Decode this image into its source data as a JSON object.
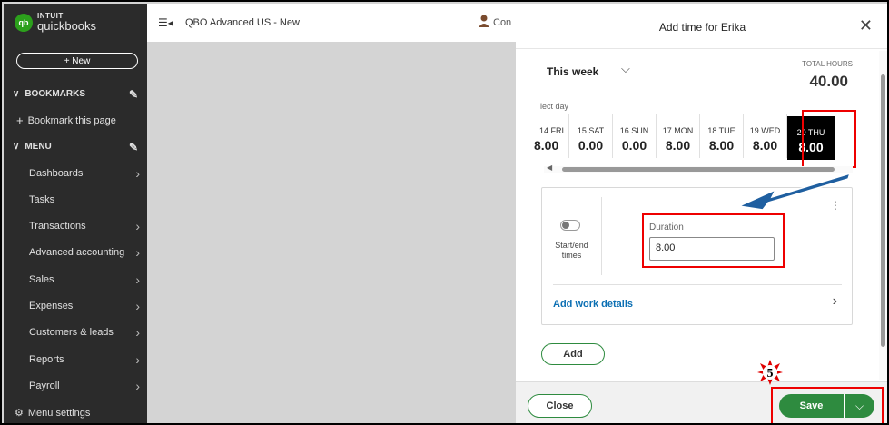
{
  "sidebar": {
    "logo_top": "INTUIT",
    "logo_bottom": "quickbooks",
    "logo_badge": "qb",
    "new_label": "+ New",
    "bookmarks_label": "BOOKMARKS",
    "bookmark_this_page": "Bookmark this page",
    "menu_label": "MENU",
    "items": [
      {
        "label": "Dashboards",
        "chevron": true
      },
      {
        "label": "Tasks",
        "chevron": false
      },
      {
        "label": "Transactions",
        "chevron": true
      },
      {
        "label": "Advanced accounting",
        "chevron": true
      },
      {
        "label": "Sales",
        "chevron": true
      },
      {
        "label": "Expenses",
        "chevron": true
      },
      {
        "label": "Customers & leads",
        "chevron": true
      },
      {
        "label": "Reports",
        "chevron": true
      },
      {
        "label": "Payroll",
        "chevron": true
      }
    ],
    "menu_settings": "Menu settings"
  },
  "topbar": {
    "company": "QBO Advanced US - New",
    "contact_text": "Con"
  },
  "panel": {
    "title": "Add time for Erika",
    "week_label": "This week",
    "total_hours_label": "TOTAL HOURS",
    "total_hours_value": "40.00",
    "select_day_label": "lect day",
    "days": [
      {
        "name": "14 FRI",
        "hours": "8.00"
      },
      {
        "name": "15 SAT",
        "hours": "0.00"
      },
      {
        "name": "16 SUN",
        "hours": "0.00"
      },
      {
        "name": "17 MON",
        "hours": "8.00"
      },
      {
        "name": "18 TUE",
        "hours": "8.00"
      },
      {
        "name": "19 WED",
        "hours": "8.00"
      },
      {
        "name": "20 THU",
        "hours": "8.00"
      }
    ],
    "start_end_label": "Start/end times",
    "duration_label": "Duration",
    "duration_value": "8.00",
    "work_details": "Add work details",
    "add_label": "Add",
    "close_label": "Close",
    "save_label": "Save"
  },
  "annotation": {
    "step_number": "5",
    "highlight_color": "#e00000",
    "arrow_color": "#1f5fa0"
  },
  "colors": {
    "sidebar_bg": "#2b2b2b",
    "brand_green": "#2e8b3f",
    "link_blue": "#0b6fb3"
  }
}
